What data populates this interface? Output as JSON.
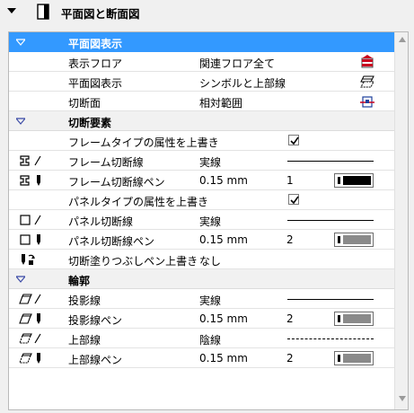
{
  "panel": {
    "title": "平面図と断面図"
  },
  "groups": {
    "floorplan": {
      "title": "平面図表示",
      "rows": [
        {
          "label": "表示フロア",
          "value": "関連フロア全て",
          "icon": "floors-icon"
        },
        {
          "label": "平面図表示",
          "value": "シンボルと上部線",
          "icon": "symbol-display-icon"
        },
        {
          "label": "切断面",
          "value": "相対範囲",
          "icon": "cut-plane-icon"
        }
      ]
    },
    "cut": {
      "title": "切断要素",
      "override_frame": "フレームタイプの属性を上書き",
      "frame_cut_line": {
        "label": "フレーム切断線",
        "value": "実線"
      },
      "frame_cut_pen": {
        "label": "フレーム切断線ペン",
        "value": "0.15 mm",
        "pen": "1"
      },
      "override_panel": "パネルタイプの属性を上書き",
      "panel_cut_line": {
        "label": "パネル切断線",
        "value": "実線"
      },
      "panel_cut_pen": {
        "label": "パネル切断線ペン",
        "value": "0.15 mm",
        "pen": "2"
      },
      "fill_pen": {
        "label": "切断塗りつぶしペン上書き",
        "value": "なし"
      }
    },
    "outline": {
      "title": "輪郭",
      "proj_line": {
        "label": "投影線",
        "value": "実線"
      },
      "proj_pen": {
        "label": "投影線ペン",
        "value": "0.15 mm",
        "pen": "2"
      },
      "over_line": {
        "label": "上部線",
        "value": "陰線"
      },
      "over_pen": {
        "label": "上部線ペン",
        "value": "0.15 mm",
        "pen": "2"
      }
    }
  },
  "colors": {
    "selection": "#3399ff",
    "accent_icon": "#c8001e",
    "pen1": "#000000",
    "pen2": "#8a8a8a"
  }
}
